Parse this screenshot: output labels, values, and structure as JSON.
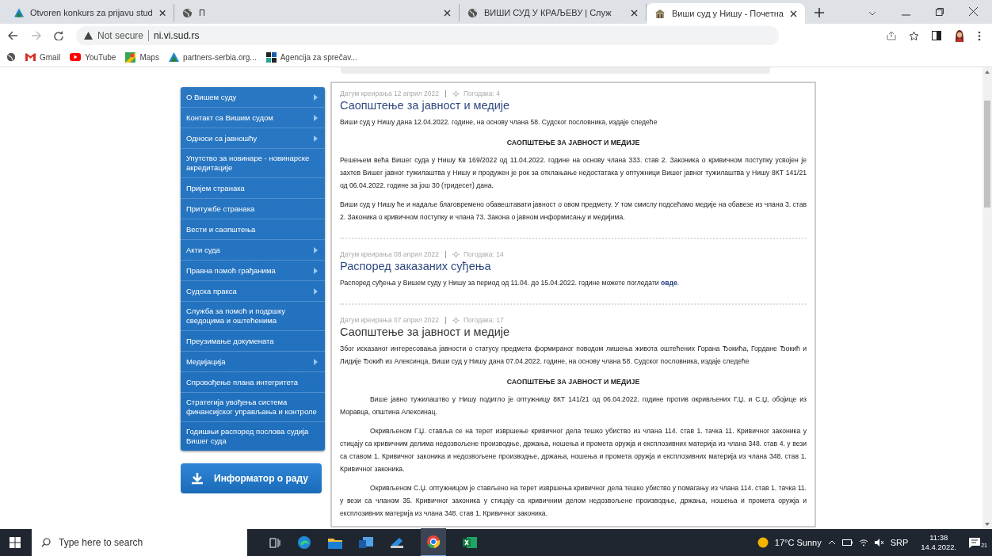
{
  "browser": {
    "tabs": [
      {
        "title": "Otvoren konkurs za prijavu stud",
        "selected": false
      },
      {
        "title": "П",
        "selected": false
      },
      {
        "title": "ВИШИ СУД У КРАЉЕВУ | Служ",
        "selected": false
      },
      {
        "title": "Виши суд у Нишу - Почетна",
        "selected": true
      }
    ],
    "address": {
      "security": "Not secure",
      "url": "ni.vi.sud.rs"
    },
    "bookmarks": [
      {
        "label": "Gmail"
      },
      {
        "label": "YouTube"
      },
      {
        "label": "Maps"
      },
      {
        "label": "partners-serbia.org..."
      },
      {
        "label": "Agencija za sprečav..."
      }
    ]
  },
  "sidebar": {
    "items": [
      {
        "label": "О Вишем суду",
        "has_submenu": true
      },
      {
        "label": "Контакт са Вишим судом",
        "has_submenu": true
      },
      {
        "label": "Односи са јавношћу",
        "has_submenu": true
      },
      {
        "label": "Упутство за новинаре - новинарске акредитације",
        "has_submenu": false
      },
      {
        "label": "Пријем странака",
        "has_submenu": false
      },
      {
        "label": "Притужбе странака",
        "has_submenu": false
      },
      {
        "label": "Вести и саопштења",
        "has_submenu": false
      },
      {
        "label": "Акти суда",
        "has_submenu": true
      },
      {
        "label": "Правна помоћ грађанима",
        "has_submenu": true
      },
      {
        "label": "Судска пракса",
        "has_submenu": true
      },
      {
        "label": "Служба за помоћ и подршку сведоцима и оштећенима",
        "has_submenu": false
      },
      {
        "label": "Преузимање докумената",
        "has_submenu": false
      },
      {
        "label": "Медијација",
        "has_submenu": true
      },
      {
        "label": "Спровођење плана интегритета",
        "has_submenu": false
      },
      {
        "label": "Стратегија увођења система финансијског управљања и контроле",
        "has_submenu": false
      },
      {
        "label": "Годишњи распоред послова судија Вишег суда",
        "has_submenu": false
      }
    ],
    "informator_button": "Информатор о раду"
  },
  "articles": [
    {
      "date": "Датум креирања 12 април 2022",
      "views": "Погодака: 4",
      "title": "Саопштење за јавност и медије",
      "blocks": [
        {
          "kind": "p",
          "text": "Виши суд у Нишу дана 12.04.2022. године, на основу члана 58. Судског пословника, издаје следеће"
        },
        {
          "kind": "heading",
          "text": "САОПШТЕЊЕ ЗА ЈАВНОСТ И МЕДИЈЕ"
        },
        {
          "kind": "p",
          "text": "Решењем већа Вишег суда у Нишу Кв 169/2022 од 11.04.2022. године на основу члана 333. став 2. Законика о кривичном поступку усвојен је захтев Вишег јавног тужилаштва у Нишу и продужен је рок за отклањање недостатака у оптужници Вишег јавног тужилаштва у Нишу 8КТ 141/21 од 06.04.2022. године за још 30 (тридесет) дана."
        },
        {
          "kind": "p",
          "text": "Виши суд у Нишу ће и надаље благовремено обавештавати јавност о овом предмету. У том смислу подсећамо медије на обавезе из члана 3. став 2. Законика о кривичном поступку и члана 73. Закона о јавном информисању и медијима."
        }
      ]
    },
    {
      "date": "Датум креирања 08 април 2022",
      "views": "Погодака: 14",
      "title": "Распоред заказаних суђења",
      "blocks": [
        {
          "kind": "link_p",
          "text": "Распоред суђења у Вишем суду у Нишу за период од 11.04. до 15.04.2022. године можете погледати ",
          "link": "овде",
          "tail": "."
        }
      ]
    },
    {
      "date": "Датум креирања 07 април 2022",
      "views": "Погодака: 17",
      "title": "Саопштење за јавност и медије",
      "blocks": [
        {
          "kind": "p",
          "text": "Због исказаног интересовања јавности о статусу предмета формираног поводом лишења живота оштећених Горана Ђокића, Гордане Ђокић и Лидије Ђокић из Алексинца, Виши суд у Нишу дана 07.04.2022. године, на основу члана 58. Судског пословника, издаје следеће"
        },
        {
          "kind": "heading",
          "text": "САОПШТЕЊЕ ЗА ЈАВНОСТ И МЕДИЈЕ"
        },
        {
          "kind": "indent",
          "text": "Више јавно тужилаштво у Нишу подигло је оптужницу 8КТ 141/21 од 06.04.2022. године против окривљених Г.Џ. и С.Џ, обојице из Моравца, општина Алексинац."
        },
        {
          "kind": "indent",
          "text": "Окривљеном Г.Џ. ставља се на терет извршење кривичног дела тешко убиство из члана 114. став 1. тачка 11. Кривичног законика у стицају са кривичним делима недозвољене производње, држања, ношења и промета оружја и експлозивних материја из члана 348. став 4. у вези са ставом 1. Кривичног законика и недозвољене производње, држања, ношења и промета оружја и експлозивних материја из члана 348. став 1. Кривичног законика."
        },
        {
          "kind": "indent",
          "text": "Окривљеном С.Џ. оптужницом је стављено на терет извршења кривичног дела тешко убиство у помагању из члана 114. став 1. тачка 11. у вези са чланом 35. Кривичног законика у стицају са кривичним делом недозвољене производње, држања, ношења и промета оружја и експлозивних материја из члана 348. став 1. Кривичног законика."
        }
      ]
    }
  ],
  "taskbar": {
    "search_placeholder": "Type here to search",
    "weather": "17°C Sunny",
    "language": "SRP",
    "time": "11:38",
    "date": "14.4.2022.",
    "notifications": "21"
  }
}
